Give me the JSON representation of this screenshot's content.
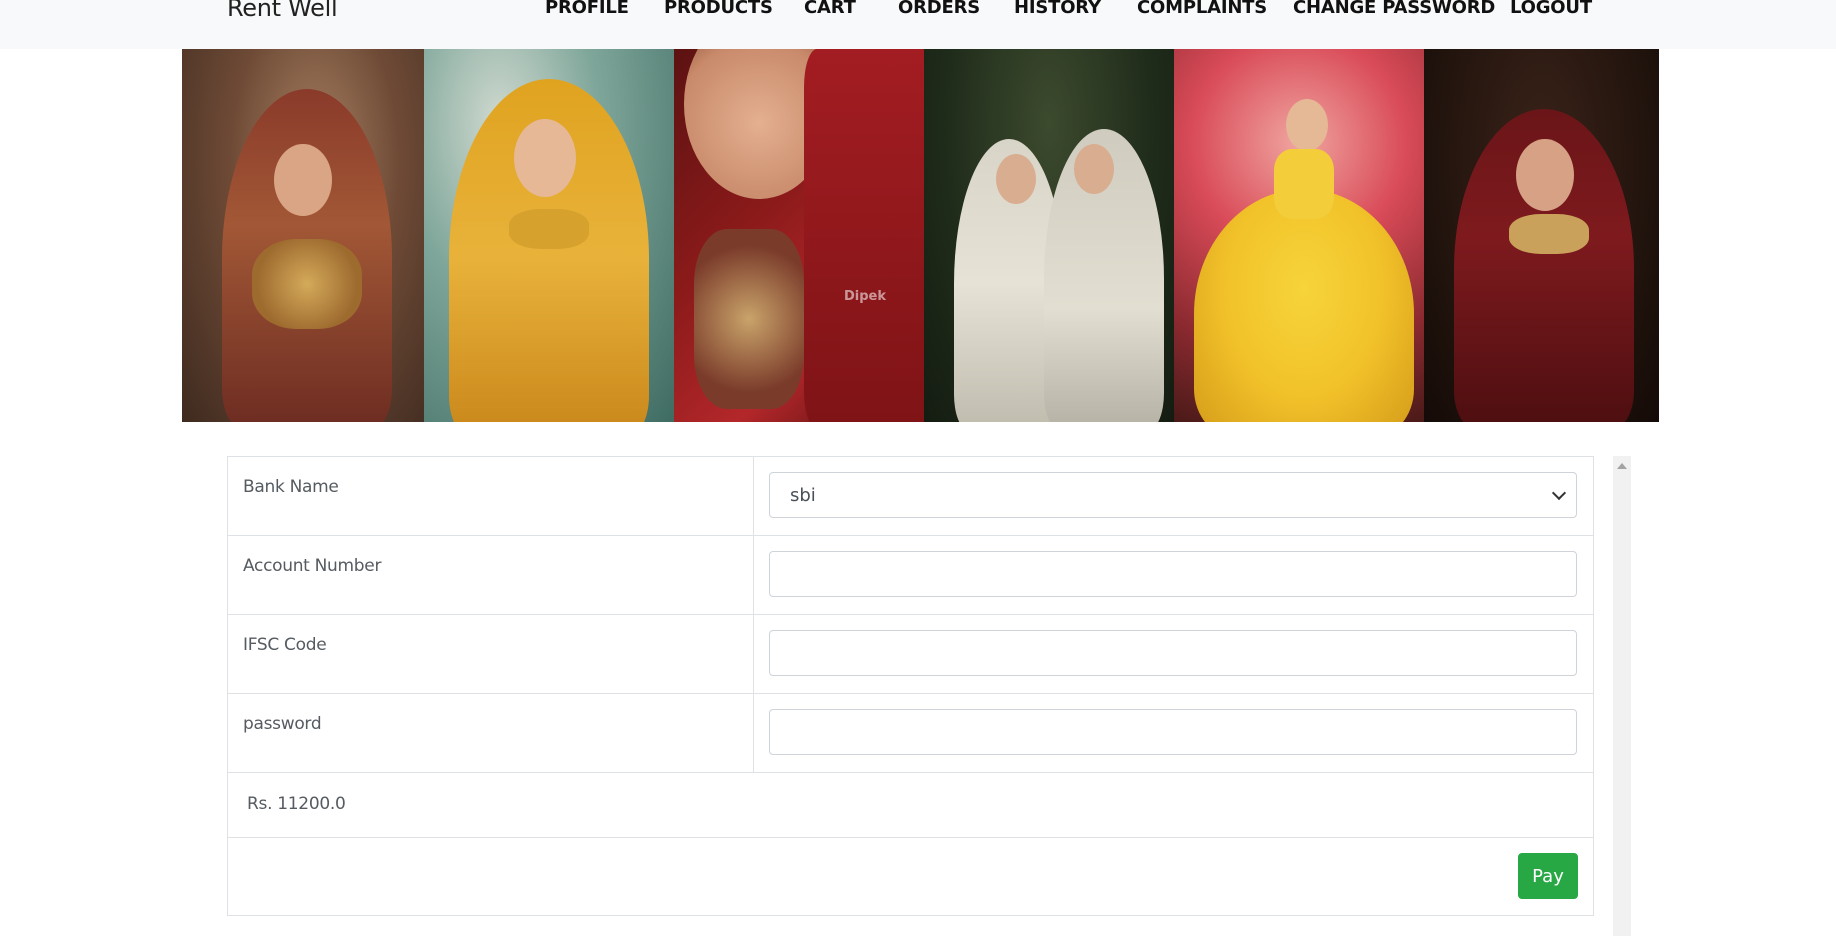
{
  "navbar": {
    "brand": "Rent Well",
    "links": [
      "PROFILE",
      "PRODUCTS",
      "CART",
      "ORDERS",
      "HISTORY",
      "COMPLAINTS",
      "CHANGE PASSWORD",
      "LOGOUT"
    ]
  },
  "banner": {
    "watermark": "Dipek"
  },
  "form": {
    "bank_name_label": "Bank Name",
    "bank_name_value": "sbi",
    "account_number_label": "Account Number",
    "account_number_value": "",
    "ifsc_label": "IFSC Code",
    "ifsc_value": "",
    "password_label": "password",
    "password_value": "",
    "amount": "Rs. 11200.0",
    "pay_label": "Pay"
  },
  "colors": {
    "navbar_bg": "#f8f9fa",
    "pay_button": "#28a745",
    "border": "#dee2e6"
  }
}
